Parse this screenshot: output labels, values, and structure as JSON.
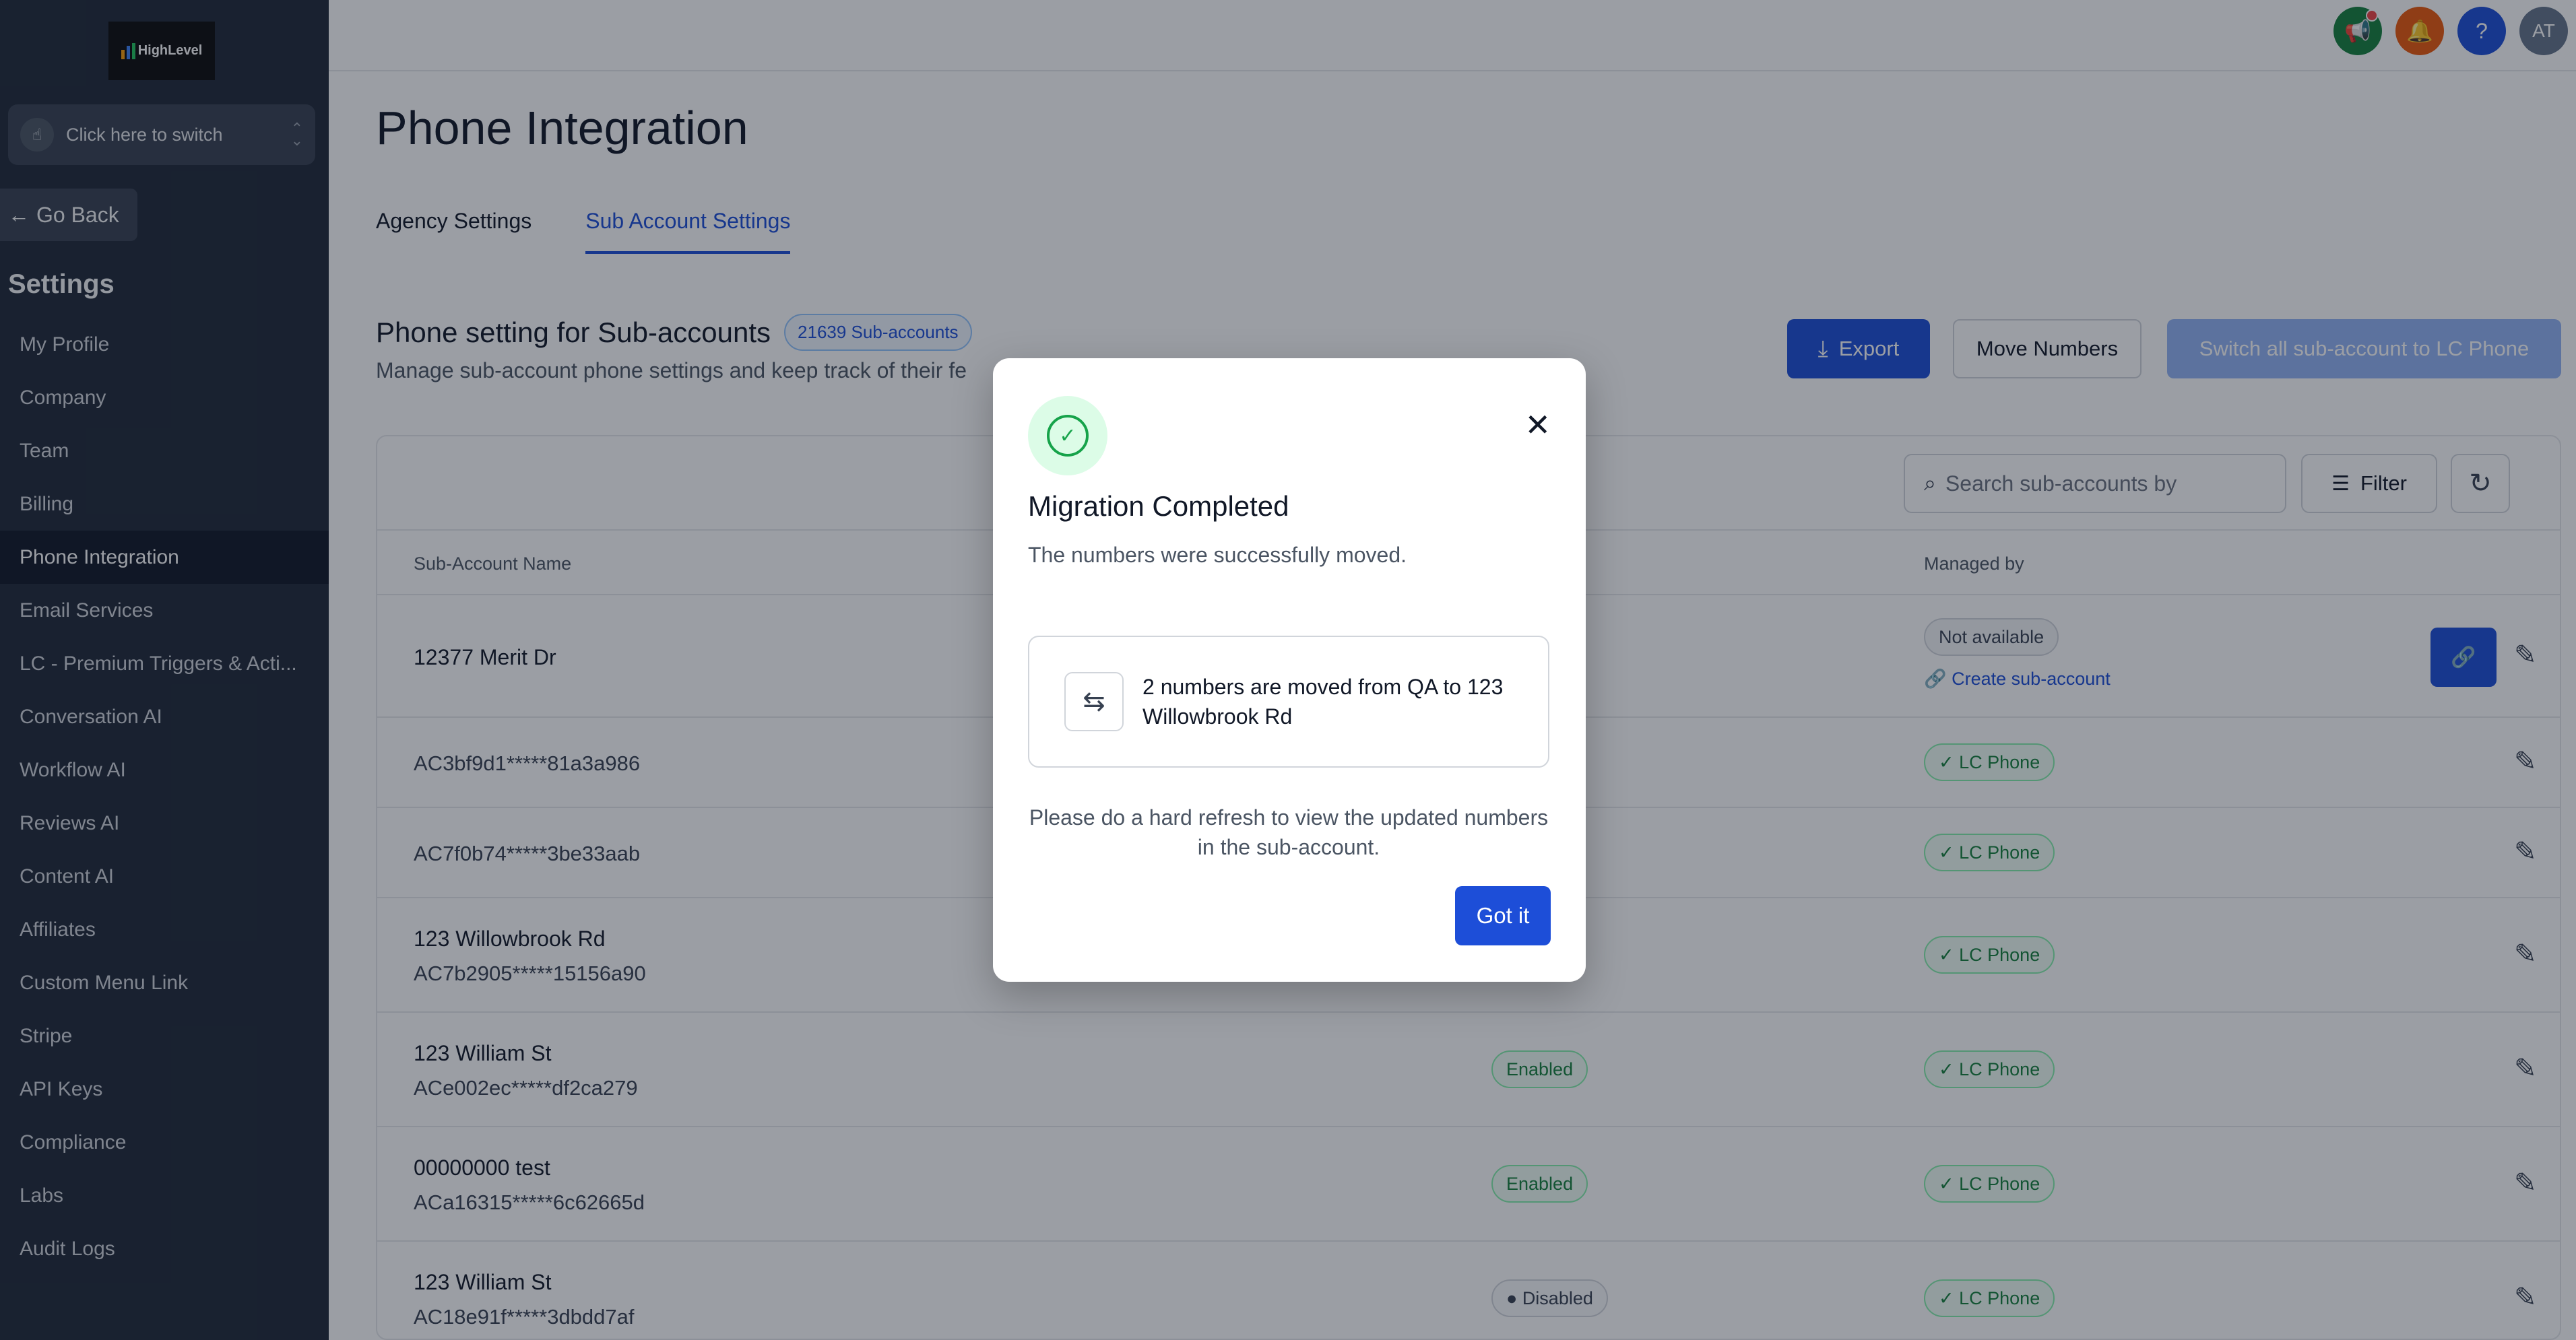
{
  "sidebar": {
    "logo_text": "HighLevel",
    "switcher_label": "Click here to switch",
    "go_back": "Go Back",
    "settings_heading": "Settings",
    "items": [
      {
        "label": "My Profile"
      },
      {
        "label": "Company"
      },
      {
        "label": "Team"
      },
      {
        "label": "Billing"
      },
      {
        "label": "Phone Integration"
      },
      {
        "label": "Email Services"
      },
      {
        "label": "LC - Premium Triggers & Acti..."
      },
      {
        "label": "Conversation AI"
      },
      {
        "label": "Workflow AI"
      },
      {
        "label": "Reviews AI"
      },
      {
        "label": "Content AI"
      },
      {
        "label": "Affiliates"
      },
      {
        "label": "Custom Menu Link"
      },
      {
        "label": "Stripe"
      },
      {
        "label": "API Keys"
      },
      {
        "label": "Compliance"
      },
      {
        "label": "Labs"
      },
      {
        "label": "Audit Logs"
      }
    ]
  },
  "topbar": {
    "avatar_initials": "AT"
  },
  "page": {
    "title": "Phone Integration",
    "tabs": [
      {
        "label": "Agency Settings"
      },
      {
        "label": "Sub Account Settings"
      }
    ],
    "section_title": "Phone setting for Sub-accounts",
    "count_badge": "21639 Sub-accounts",
    "section_sub": "Manage sub-account phone settings and keep track of their fe",
    "buttons": {
      "export": "Export",
      "move": "Move Numbers",
      "switch_all": "Switch all sub-account to LC Phone"
    },
    "search_placeholder": "Search sub-accounts by",
    "filter_label": "Filter"
  },
  "table": {
    "headers": {
      "name": "Sub-Account Name",
      "managed": "Managed by"
    },
    "rows": [
      {
        "name": "12377 Merit Dr",
        "acct": "",
        "status": "",
        "managed": "Not available",
        "link": "Create sub-account"
      },
      {
        "name": "",
        "acct": "AC3bf9d1*****81a3a986",
        "status": "",
        "managed": "LC Phone"
      },
      {
        "name": "",
        "acct": "AC7f0b74*****3be33aab",
        "status": "",
        "managed": "LC Phone"
      },
      {
        "name": "123 Willowbrook Rd",
        "acct": "AC7b2905*****15156a90",
        "status": "",
        "managed": "LC Phone"
      },
      {
        "name": "123 William St",
        "acct": "ACe002ec*****df2ca279",
        "status": "Enabled",
        "managed": "LC Phone"
      },
      {
        "name": "00000000 test",
        "acct": "ACa16315*****6c62665d",
        "status": "Enabled",
        "managed": "LC Phone"
      },
      {
        "name": "123 William St",
        "acct": "AC18e91f*****3dbdd7af",
        "status": "Disabled",
        "managed": "LC Phone"
      }
    ]
  },
  "modal": {
    "title": "Migration Completed",
    "subtitle": "The numbers were successfully moved.",
    "info": "2 numbers are moved from QA to 123 Willowbrook Rd",
    "note": "Please do a hard refresh to view the updated numbers in the sub-account.",
    "button": "Got it"
  },
  "colors": {
    "accent": "#1d4ed8",
    "success": "#16a34a",
    "sidebar": "#1f2937"
  }
}
